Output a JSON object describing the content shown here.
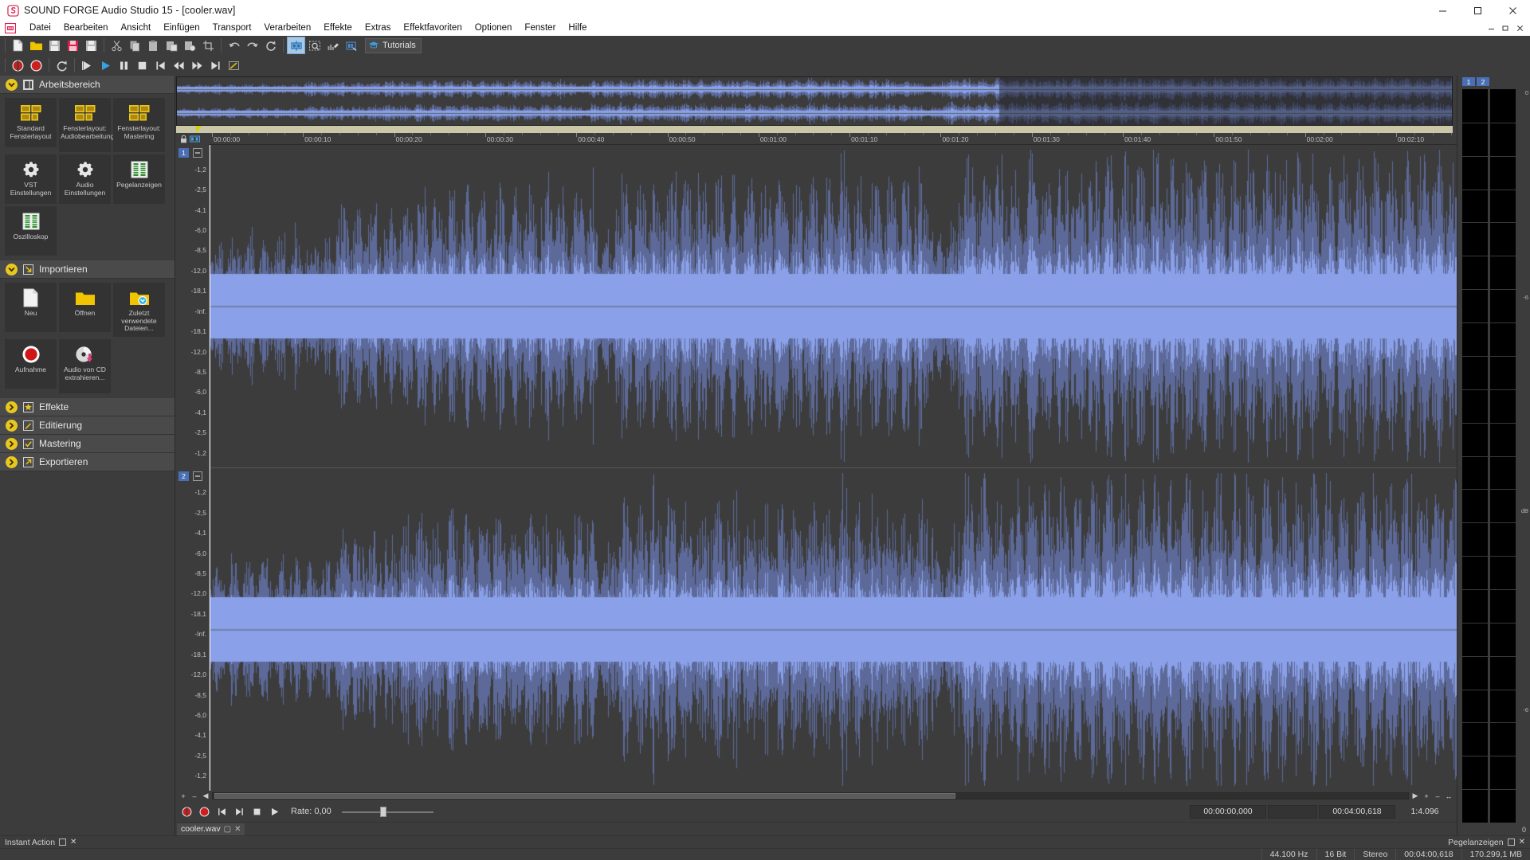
{
  "window": {
    "title": "SOUND FORGE Audio Studio 15 - [cooler.wav]",
    "app_icon": "sound-forge-logo",
    "buttons": {
      "minimize": "–",
      "maximize": "▢",
      "close": "✕"
    },
    "mdi_buttons": {
      "minimize": "–",
      "restore": "▢",
      "close": "✕"
    }
  },
  "menu": {
    "icon": "document-icon",
    "items": [
      "Datei",
      "Bearbeiten",
      "Ansicht",
      "Einfügen",
      "Transport",
      "Verarbeiten",
      "Effekte",
      "Extras",
      "Effektfavoriten",
      "Optionen",
      "Fenster",
      "Hilfe"
    ]
  },
  "toolbar_main": {
    "groups": [
      [
        "new-file",
        "open-folder",
        "save",
        "save-as-template",
        "save-all"
      ],
      [
        "cut",
        "copy",
        "paste",
        "paste-special",
        "mix-paste",
        "crop"
      ],
      [
        "undo",
        "redo",
        "repeat"
      ],
      [
        "edit-tool",
        "zoom-select-tool",
        "pencil-tool",
        "magnify-tool"
      ]
    ],
    "tutorials_label": "Tutorials",
    "tutorials_icon": "graduation-cap-icon",
    "active_tool": "edit-tool"
  },
  "toolbar_transport": {
    "buttons": [
      "record-arm",
      "record",
      "loop",
      "play-all",
      "play",
      "pause",
      "stop",
      "go-to-start",
      "rewind",
      "fast-forward",
      "go-to-end",
      "selection-marker"
    ]
  },
  "sidebar": {
    "sections": [
      {
        "title": "Arbeitsbereich",
        "icon": "workspace-icon",
        "expanded": true,
        "tiles": [
          {
            "label": "Standard Fensterlayout",
            "icon": "layout-icon"
          },
          {
            "label": "Fensterlayout: Audiobearbeitung",
            "icon": "layout-icon"
          },
          {
            "label": "Fensterlayout: Mastering",
            "icon": "layout-icon"
          },
          {
            "label": "VST Einstellungen",
            "icon": "gear-icon"
          },
          {
            "label": "Audio Einstellungen",
            "icon": "gear-icon"
          },
          {
            "label": "Pegelanzeigen",
            "icon": "level-meter-icon"
          },
          {
            "label": "Oszilloskop",
            "icon": "oscilloscope-icon"
          }
        ]
      },
      {
        "title": "Importieren",
        "icon": "import-arrow-icon",
        "expanded": true,
        "tiles": [
          {
            "label": "Neu",
            "icon": "new-document-icon"
          },
          {
            "label": "Öffnen",
            "icon": "open-folder-icon"
          },
          {
            "label": "Zuletzt verwendete Dateien...",
            "icon": "recent-files-icon"
          },
          {
            "label": "Aufnahme",
            "icon": "record-circle-icon"
          },
          {
            "label": "Audio von CD extrahieren...",
            "icon": "cd-rip-icon"
          }
        ]
      },
      {
        "title": "Effekte",
        "icon": "star-icon",
        "expanded": false,
        "tiles": []
      },
      {
        "title": "Editierung",
        "icon": "pencil-icon",
        "expanded": false,
        "tiles": []
      },
      {
        "title": "Mastering",
        "icon": "check-icon",
        "expanded": false,
        "tiles": []
      },
      {
        "title": "Exportieren",
        "icon": "export-arrow-icon",
        "expanded": false,
        "tiles": []
      }
    ]
  },
  "timeline": {
    "lock_icon": "lock-icon",
    "marker_icon": "marker-tool-icon",
    "ticks": [
      "00:00:00",
      "00:00:10",
      "00:00:20",
      "00:00:30",
      "00:00:40",
      "00:00:50",
      "00:01:00",
      "00:01:10",
      "00:01:20",
      "00:01:30",
      "00:01:40",
      "00:01:50",
      "00:02:00",
      "00:02:10"
    ]
  },
  "waveform": {
    "channels": [
      {
        "number": "1",
        "mute_icon": "mute-icon"
      },
      {
        "number": "2",
        "mute_icon": "mute-icon"
      }
    ],
    "db_scale": [
      "-1,2",
      "-2,5",
      "-4,1",
      "-6,0",
      "-8,5",
      "-12,0",
      "-18,1",
      "-Inf.",
      "-18,1",
      "-12,0",
      "-8,5",
      "-6,0",
      "-4,1",
      "-2,5",
      "-1,2"
    ]
  },
  "transport_bar": {
    "buttons": [
      "record-arm",
      "record",
      "go-to-start",
      "go-to-end",
      "stop",
      "play"
    ],
    "rate_label": "Rate: 0,00",
    "rate_value": 0.0,
    "time_start": "00:00:00,000",
    "time_end": "00:04:00,618",
    "zoom_ratio": "1:4.096",
    "zoom_icons": [
      "zoom-in-icon",
      "zoom-out-icon",
      "zoom-fit-icon"
    ]
  },
  "tabs": [
    {
      "label": "cooler.wav",
      "restore_icon": "restore-icon",
      "close_icon": "close-icon"
    }
  ],
  "meters": {
    "channel_labels": [
      "1",
      "2"
    ],
    "scale_top": "0",
    "scale_marks": [
      "-6",
      "-6"
    ],
    "unit": "dB",
    "title": "Pegelanzeigen",
    "footer_icons": [
      "meter-restore-icon",
      "meter-close-icon"
    ]
  },
  "status_left": {
    "label": "Instant Action",
    "restore_icon": "restore-icon",
    "close_icon": "close-icon"
  },
  "status_bar": {
    "cells": [
      "44.100 Hz",
      "16 Bit",
      "Stereo",
      "00:04:00,618",
      "170.299,1 MB"
    ]
  },
  "colors": {
    "accent_yellow": "#e8c820",
    "waveform": "#7e96e0",
    "waveform_dark": "#56617f",
    "selection": "#4b6fb5",
    "panel_bg": "#3c3c3c",
    "tile_bg": "#333333",
    "overview_bar": "#c9c7a8",
    "record_red": "#d42020"
  }
}
